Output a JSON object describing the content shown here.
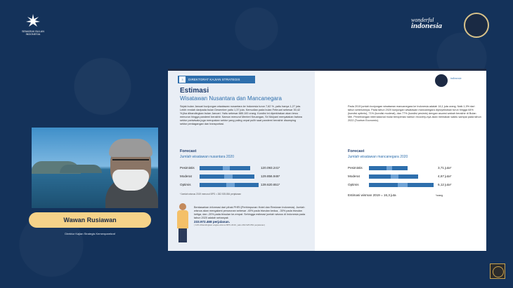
{
  "header": {
    "left_logo_text": "SEMARAK BULAN INDONESIA",
    "wonderful_line1": "wonderful",
    "wonderful_line2": "indonesia"
  },
  "participant": {
    "name": "Wawan Rusiawan",
    "title": "Direktur Kajian Strategis Kemenparekraf"
  },
  "slide": {
    "section_number": "3",
    "section_label": "DIREKTORAT KAJIAN STRATEGIS",
    "title": "Estimasi",
    "subtitle": "Wisatawan Nusantara dan Mancanegara",
    "left_paragraph": "Sejak bulan Januari kunjungan wisatawan nusantara ke Indonesia turun 7,62 %, yaitu hanya 1,27 juta. Lebih rendah daripada bulan Desember yaitu 1,37 juta. Kemudian pada bulan Februari sebesar 30,42 % jika dibandingkan bulan Januari. Yaitu sebesar 885.100 orang. Kondisi ini diperkirakan akan terus menurun hingga pandemi berakhir. Namun menurut Menteri Keuangan, Sri Mulyani menyatakan bahwa sektor pariwisata juga merupakan sektor yang paling cepat pulih saat pandemi berakhir disamping sektor perdagangan dan transportasi.",
    "right_paragraph": "Pada 2019 jumlah kunjungan wisatawan mancanegara ke Indonesia adalah 16,1 juta orang. Naik 1,9% dari tahun sebelumnya. Pada tahun 2020 kunjungan wisatawan mancanegara diproyeksikan turun hingga 64% (kondisi optimis), 71% (kondisi moderat), dan 77% (kondisi pesimis) dengan asumsi wabah berakhir di Bulan Mei. Penerbangan internasional mulai beroperasi namun recovery-nya akan memakan waktu sampai pada tahun 2022 (Tourism Economic).",
    "forecast_left": {
      "title": "Forecast",
      "subtitle": "Jumlah wisatawan nusantara 2020",
      "rows": [
        {
          "label": "Pesimistis",
          "value": "120.093.241*",
          "fraction": 0.86
        },
        {
          "label": "Moderat",
          "value": "129.856.946*",
          "fraction": 0.93
        },
        {
          "label": "Optimis",
          "value": "139.620.651*",
          "fraction": 1.0
        }
      ],
      "note": "*Jumlah wisnus 2019 menurut BPS = 282.925.854 perjalanan"
    },
    "forecast_right": {
      "title": "Forecast",
      "subtitle": "Jumlah wisatawan mancanegara 2020",
      "rows": [
        {
          "label": "Pesimistis",
          "value": "3,71 juta*",
          "fraction": 0.6
        },
        {
          "label": "Moderat",
          "value": "4,67 juta*",
          "fraction": 0.76
        },
        {
          "label": "Optimis",
          "value": "6,12 juta*",
          "fraction": 1.0
        }
      ],
      "estimate": "Estimasi wisman 2019 = 16,3 juta",
      "estimate_note": "*orang"
    },
    "bottom_text": "Berdasarkan informasi dari pihak PHRI (Perhimpunan Hotel dan Restoran Indonesia). Jumlah wisnus akan mengalami penurunan sebesar -40% pada triwulan kedua, -30% pada triwulan ketiga, dan -20% pada triwulan ke-empat. Sehingga estimasi jumlah wisnus di Indonesia pada tahun 2020 adalah sebanyak",
    "bottom_strong": "233.972.468 perjalanan.",
    "bottom_foot": "( 11% dibandingkan angka wisnus BPS 2019, yaitu 282.925.854 perjalanan)"
  }
}
